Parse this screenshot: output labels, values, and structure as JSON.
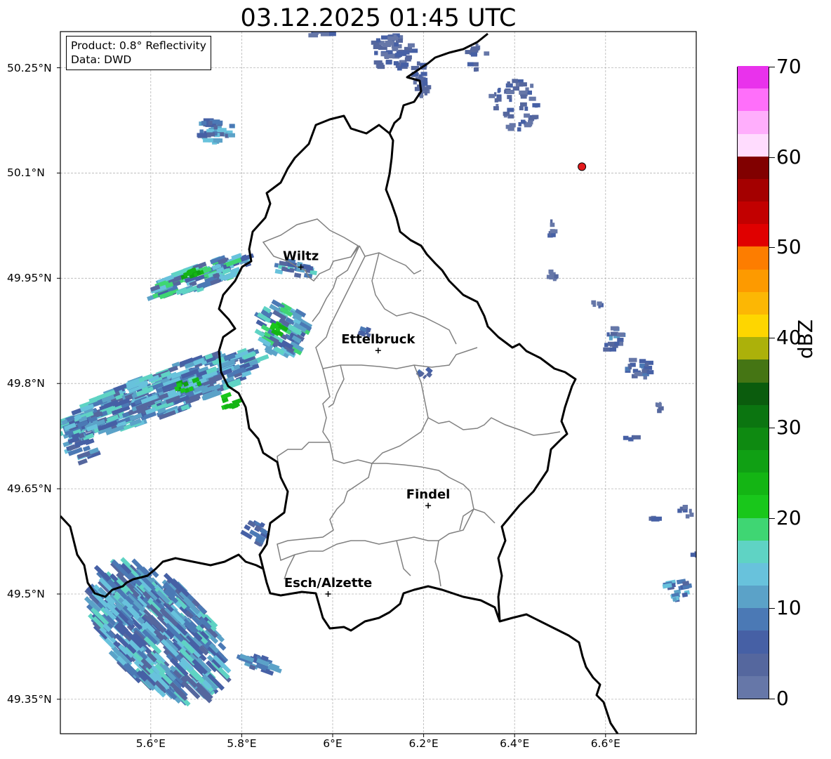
{
  "title": "03.12.2025 01:45 UTC",
  "info": {
    "product": "Product: 0.8° Reflectivity",
    "source": "Data: DWD"
  },
  "axes": {
    "lon_ticks": [
      "5.6°E",
      "5.8°E",
      "6°E",
      "6.2°E",
      "6.4°E",
      "6.6°E"
    ],
    "lat_ticks": [
      "50.25°N",
      "50.1°N",
      "49.95°N",
      "49.8°N",
      "49.65°N",
      "49.5°N",
      "49.35°N"
    ],
    "grid": true
  },
  "cities": [
    {
      "name": "Wiltz",
      "lon": 5.93,
      "lat": 49.966
    },
    {
      "name": "Ettelbruck",
      "lon": 6.1,
      "lat": 49.847
    },
    {
      "name": "Findel",
      "lon": 6.21,
      "lat": 49.626
    },
    {
      "name": "Esch/Alzette",
      "lon": 5.99,
      "lat": 49.5
    }
  ],
  "radar_site": {
    "lon": 6.548,
    "lat": 50.109,
    "color": "#e31a1c"
  },
  "colorbar": {
    "unit": "dBZ",
    "min": 0,
    "max": 70,
    "ticks": [
      "0",
      "10",
      "20",
      "30",
      "40",
      "50",
      "60",
      "70"
    ],
    "colors": [
      "#6677a8",
      "#55679e",
      "#4660a5",
      "#4b79b5",
      "#5ba2c8",
      "#68c2dc",
      "#5fd3c4",
      "#3fd673",
      "#19c71b",
      "#14b514",
      "#10a014",
      "#0e8a11",
      "#0b7510",
      "#0b5c0d",
      "#457514",
      "#acb10a",
      "#fed600",
      "#fcb704",
      "#fd9a00",
      "#fd7d00",
      "#e00000",
      "#c20000",
      "#a40000",
      "#810000",
      "#ffdcfe",
      "#ffaefc",
      "#ff6ffa",
      "#e932ec"
    ]
  }
}
